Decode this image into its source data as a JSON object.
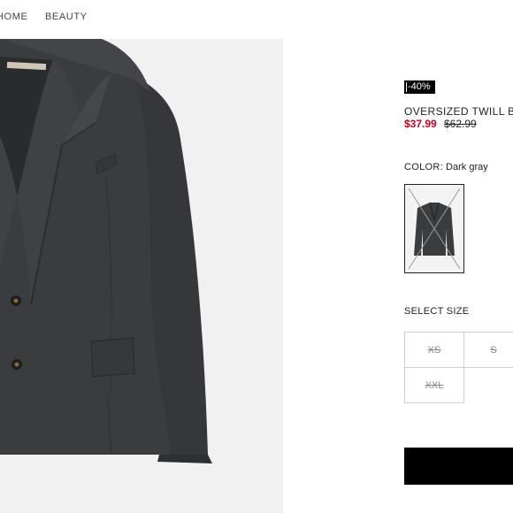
{
  "nav": {
    "items": [
      {
        "label": "HOME"
      },
      {
        "label": "BEAUTY"
      }
    ]
  },
  "product": {
    "discount_badge": "-40%",
    "title": "OVERSIZED TWILL B",
    "price_sale": "$37.99",
    "price_original": "$62.99",
    "color_label": "COLOR:",
    "color_value": "Dark gray",
    "size_title": "SELECT SIZE",
    "sizes": [
      {
        "label": "XS",
        "available": false
      },
      {
        "label": "S",
        "available": false
      },
      {
        "label": "XXL",
        "available": false
      }
    ]
  },
  "colors": {
    "jacket": "#3b3c3e",
    "image_bg": "#f1f1f1",
    "sale": "#d0001c",
    "button": "#000000"
  }
}
